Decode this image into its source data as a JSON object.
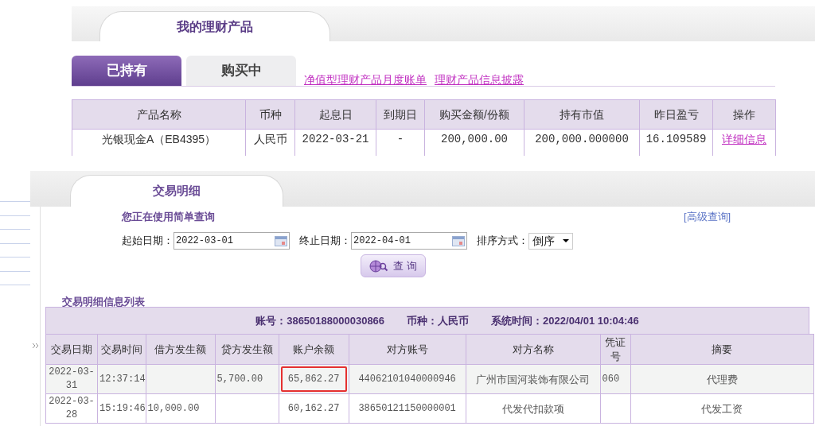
{
  "products_panel": {
    "title": "我的理财产品",
    "tabs": [
      {
        "label": "已持有",
        "selected": true
      },
      {
        "label": "购买中",
        "selected": false
      }
    ],
    "links": [
      "净值型理财产品月度账单",
      "理财产品信息披露"
    ],
    "table": {
      "columns": [
        "产品名称",
        "币种",
        "起息日",
        "到期日",
        "购买金额/份额",
        "持有市值",
        "昨日盈亏",
        "操作"
      ],
      "rows": [
        {
          "cells": [
            "光银现金A（EB4395）",
            "人民币",
            "2022-03-21",
            "-",
            "200,000.00",
            "200,000.000000",
            "16.109589"
          ],
          "action": "详细信息"
        }
      ]
    }
  },
  "transactions_panel": {
    "title": "交易明细",
    "query_mode": "您正在使用简单查询",
    "advanced_link": "[高级查询]",
    "start_label": "起始日期：",
    "start_value": "2022-03-01",
    "end_label": "终止日期：",
    "end_value": "2022-04-01",
    "sort_label": "排序方式：",
    "sort_value": "倒序",
    "query_button": "查 询",
    "list_title": "交易明细信息列表",
    "info": [
      "账号：38650188000030866",
      "币种：人民币",
      "系统时间：2022/04/01 10:04:46"
    ],
    "columns": [
      "交易日期",
      "交易时间",
      "借方发生额",
      "贷方发生额",
      "账户余额",
      "对方账号",
      "对方名称",
      "凭证号",
      "摘要"
    ],
    "rows": [
      {
        "cells": [
          "2022-03-31",
          "12:37:14",
          "",
          "5,700.00",
          "65,862.27",
          "44062101040000946",
          "广州市国河装饰有限公司",
          "060",
          "代理费"
        ],
        "balance_highlighted": true
      },
      {
        "cells": [
          "2022-03-28",
          "15:19:46",
          "10,000.00",
          "",
          "60,162.27",
          "38650121150000001",
          "代发代扣款项",
          "",
          "代发工资"
        ],
        "balance_highlighted": false
      }
    ]
  }
}
